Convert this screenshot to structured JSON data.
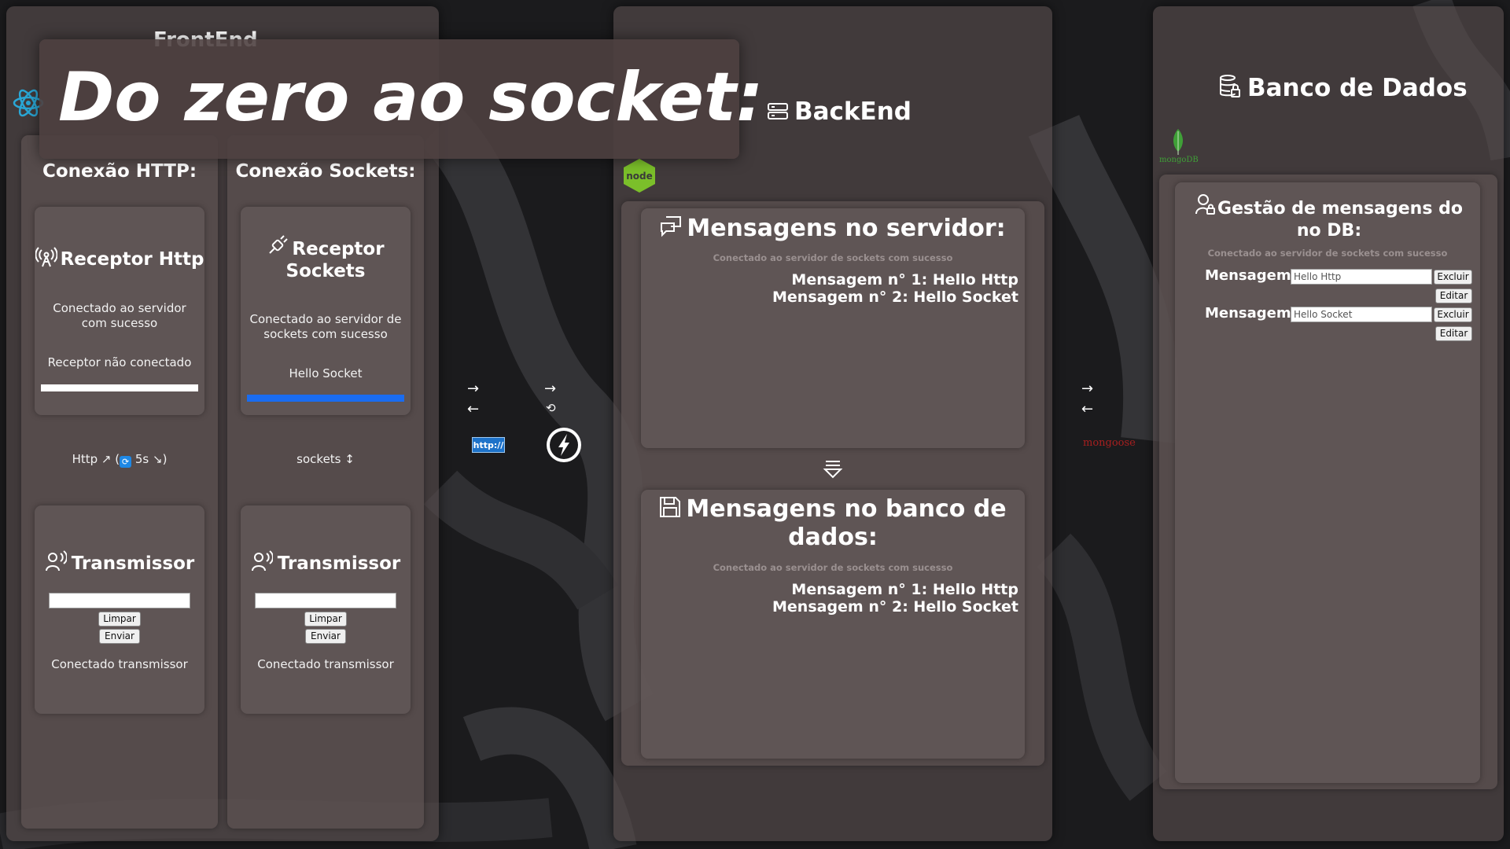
{
  "frontend": {
    "header_partial": "FrontEnd",
    "http": {
      "title": "Conexão HTTP:",
      "receptor_title": "Receptor Http",
      "receptor_status": "Conectado ao servidor com sucesso",
      "receptor_message": "Receptor não conectado",
      "connection_label_prefix": "Http ↗ (",
      "connection_label_interval": "5s ↘)",
      "transmissor_title": "Transmissor",
      "clear_label": "Limpar",
      "send_label": "Enviar",
      "transmissor_status": "Conectado transmissor"
    },
    "sockets": {
      "title": "Conexão Sockets:",
      "receptor_title_line1": "Receptor",
      "receptor_title_line2": "Sockets",
      "receptor_status": "Conectado ao servidor de sockets com sucesso",
      "receptor_message": "Hello Socket",
      "progress": 1.0,
      "connection_label": "sockets ↕",
      "transmissor_title": "Transmissor",
      "clear_label": "Limpar",
      "send_label": "Enviar",
      "transmissor_status": "Conectado transmissor"
    }
  },
  "overlay_title": "Do zero ao socket:",
  "middle": {
    "http_badge": "http://",
    "arrow_right": "→",
    "arrow_left": "←",
    "refresh": "⟲"
  },
  "backend": {
    "title": "BackEnd",
    "node_logo": "node",
    "server_messages": {
      "title": "Mensagens no servidor:",
      "status": "Conectado ao servidor de sockets com sucesso",
      "messages": [
        "Mensagem n° 1: Hello Http",
        "Mensagem n° 2: Hello Socket"
      ]
    },
    "db_messages": {
      "title": "Mensagens no banco de dados:",
      "status": "Conectado ao servidor de sockets com sucesso",
      "messages": [
        "Mensagem n° 1: Hello Http",
        "Mensagem n° 2: Hello Socket"
      ]
    }
  },
  "database": {
    "title": "Banco de Dados",
    "mongo_label": "mongoDB",
    "mongoose_label": "mongoose",
    "management": {
      "title": "Gestão de mensagens do no DB:",
      "status": "Conectado ao servidor de sockets com sucesso",
      "label": "Mensagem:",
      "rows": [
        {
          "value": "Hello Http",
          "delete_label": "Excluir",
          "edit_label": "Editar"
        },
        {
          "value": "Hello Socket",
          "delete_label": "Excluir",
          "edit_label": "Editar"
        }
      ]
    }
  },
  "colors": {
    "progress_blue": "#1a6cf0",
    "react_cyan": "#2aa7d6",
    "node_green": "#7bbf2a",
    "mongo_green": "#3fa037",
    "mongoose_red": "#a81f1f",
    "http_badge_blue": "#1d72c9"
  }
}
